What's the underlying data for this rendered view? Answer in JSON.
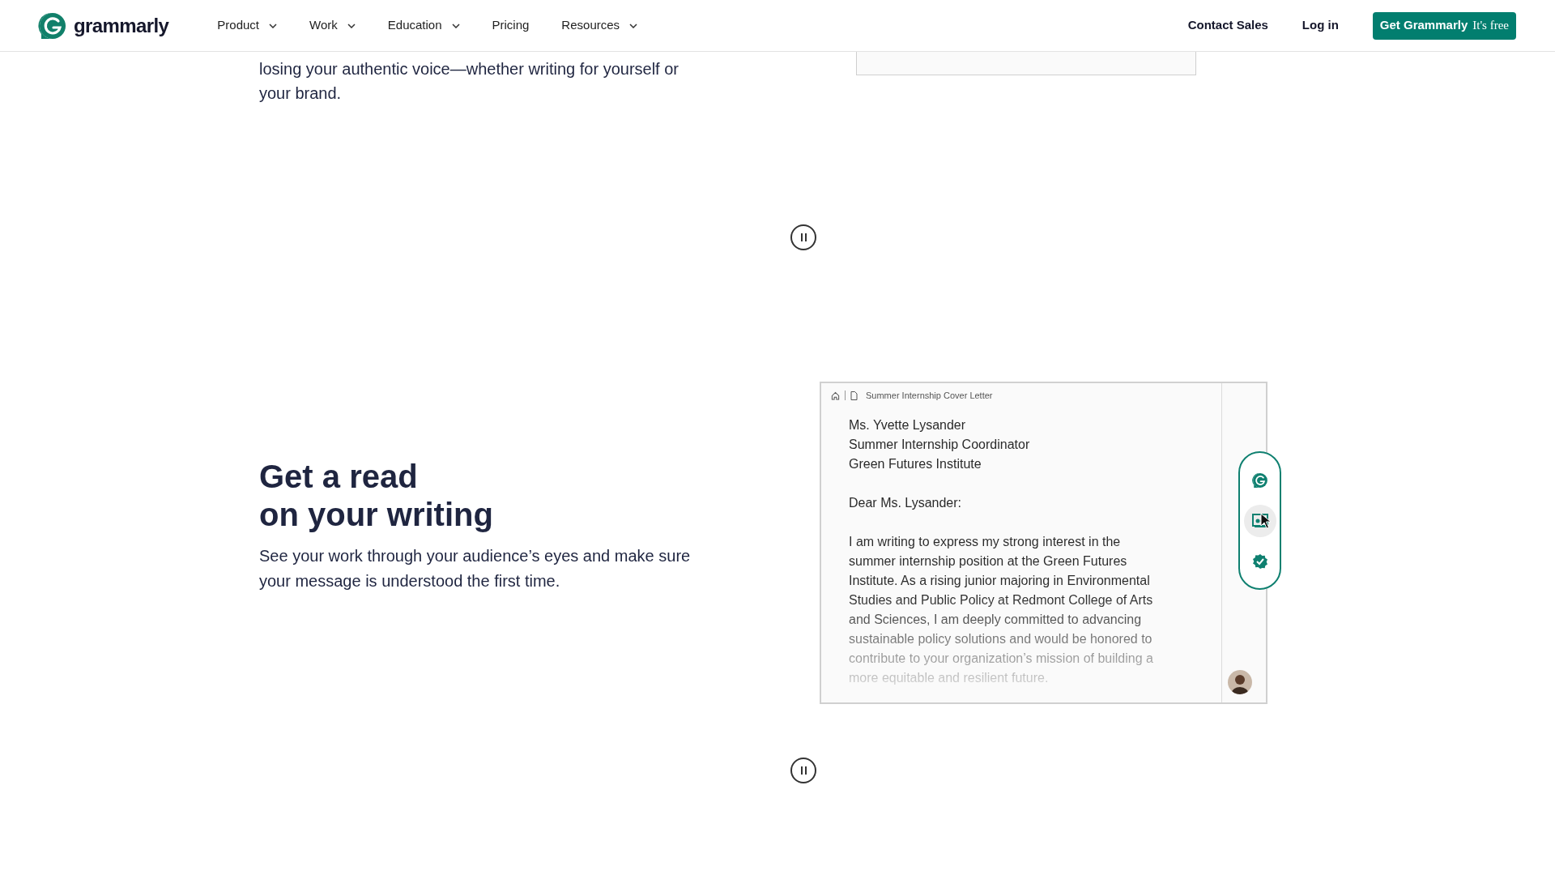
{
  "header": {
    "logo": "grammarly",
    "nav": [
      {
        "label": "Product",
        "dropdown": true
      },
      {
        "label": "Work",
        "dropdown": true
      },
      {
        "label": "Education",
        "dropdown": true
      },
      {
        "label": "Pricing",
        "dropdown": false
      },
      {
        "label": "Resources",
        "dropdown": true
      }
    ],
    "contact": "Contact Sales",
    "login": "Log in",
    "cta": {
      "label": "Get Grammarly",
      "note": "It's free"
    }
  },
  "intro_section": {
    "text_lines": [
      "losing your authentic voice—whether writing for yourself or",
      "your brand."
    ]
  },
  "feature_section": {
    "heading_lines": [
      "Get a read",
      "on your writing"
    ],
    "body": "See your work through your audience’s eyes and make sure your message is understood the first time.",
    "document": {
      "breadcrumb": "Summer Internship Cover Letter",
      "address_lines": [
        "Ms. Yvette Lysander",
        "Summer Internship Coordinator",
        "Green Futures Institute"
      ],
      "salutation": "Dear Ms. Lysander:",
      "body": "I am writing to express my strong interest in the summer internship position at the Green Futures Institute. As a rising junior majoring in Environmental Studies and Public Policy at Redmont College of Arts and Sciences, I am deeply committed to advancing sustainable policy solutions and would be honored to contribute to your organization’s mission of building a more equitable and resilient future.",
      "tools": [
        {
          "kind": "logo",
          "selected": false
        },
        {
          "kind": "audience",
          "selected": true
        },
        {
          "kind": "check",
          "selected": false
        }
      ]
    }
  }
}
